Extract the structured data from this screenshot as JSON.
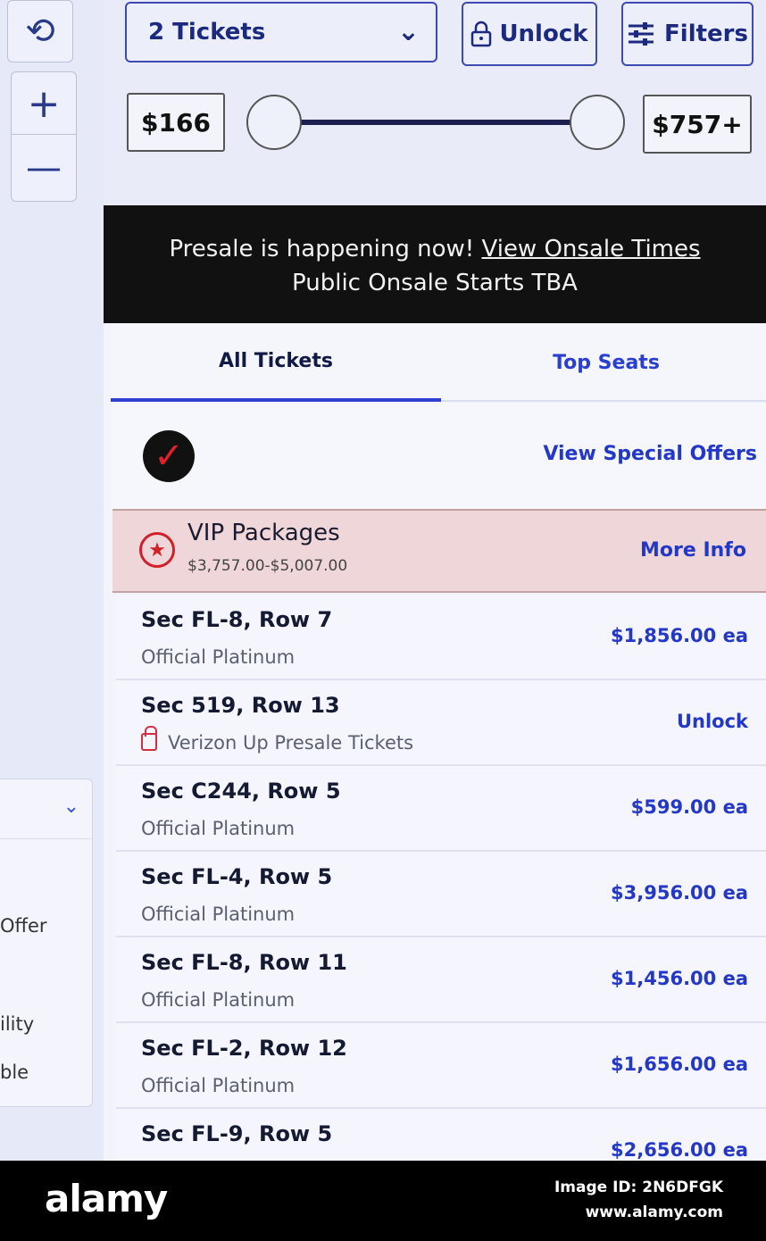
{
  "map_controls": {
    "rotate_icon": "rotate-ccw-icon",
    "zoom_in_symbol": "+",
    "zoom_out_symbol": "—"
  },
  "side_panel": {
    "items": [
      "Offer",
      "ility",
      "ble"
    ]
  },
  "toolbar": {
    "ticket_select": "2 Tickets",
    "unlock_label": "Unlock",
    "filters_label": "Filters",
    "min_price": "$166",
    "max_price": "$757+"
  },
  "banner": {
    "presale_text": "Presale is happening now!",
    "onsale_link": "View Onsale Times",
    "public_onsale": "Public Onsale Starts TBA"
  },
  "tabs": {
    "all": "All Tickets",
    "top": "Top Seats"
  },
  "offers": {
    "view_special": "View Special Offers"
  },
  "vip": {
    "title": "VIP Packages",
    "range": "$3,757.00-$5,007.00",
    "more_info": "More Info"
  },
  "listings": [
    {
      "section": "Sec FL-8, Row 7",
      "type": "Official Platinum",
      "price": "$1,856.00 ea"
    },
    {
      "section": "Sec 519, Row 13",
      "type": "Verizon Up Presale Tickets",
      "price": "Unlock"
    },
    {
      "section": "Sec C244, Row 5",
      "type": "Official Platinum",
      "price": "$599.00 ea"
    },
    {
      "section": "Sec FL-4, Row 5",
      "type": "Official Platinum",
      "price": "$3,956.00 ea"
    },
    {
      "section": "Sec FL-8, Row 11",
      "type": "Official Platinum",
      "price": "$1,456.00 ea"
    },
    {
      "section": "Sec FL-2, Row 12",
      "type": "Official Platinum",
      "price": "$1,656.00 ea"
    },
    {
      "section": "Sec FL-9, Row 5",
      "type": "",
      "price": "$2,656.00 ea"
    }
  ],
  "watermark": {
    "logo": "alamy",
    "image_id": "Image ID: 2N6DFGK",
    "url": "www.alamy.com"
  },
  "colors": {
    "accent_blue": "#2438c8",
    "vip_background": "#efd6d8",
    "banner_background": "#111111",
    "verizon_red": "#e0202a"
  }
}
